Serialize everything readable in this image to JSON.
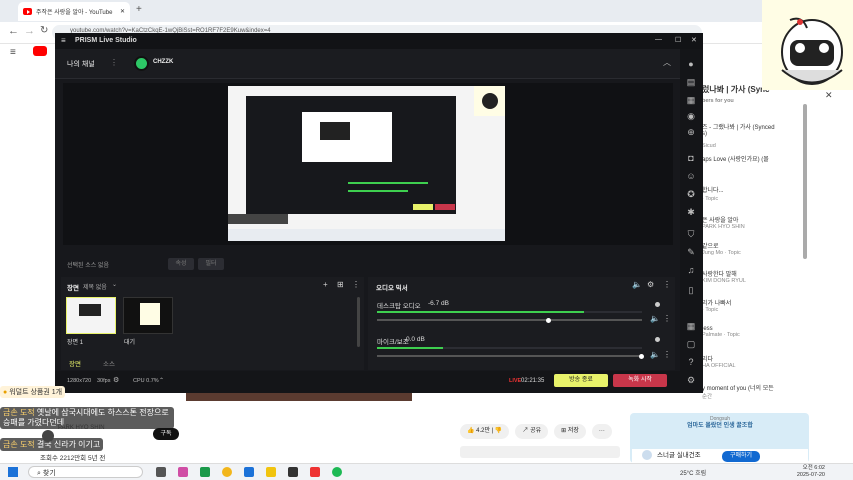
{
  "browser": {
    "tab_title": "주작은 사랑을 알아 - YouTube",
    "url": "youtube.com/watch?v=KaCtzCkqE-1wQjBiSst=RO1RF7F2E9Kuw&index=4",
    "window_controls": [
      "—",
      "☐",
      "✕"
    ]
  },
  "prism": {
    "app_name": "PRISM Live Studio",
    "channel_tab": "나의 채널",
    "channel_name": "CHZZK",
    "selected_source_label": "선택된 소스 없음",
    "source_btn_1": "속성",
    "source_btn_2": "필터",
    "scene_label": "장면",
    "scene_name_label": "제목 없음",
    "scenes": [
      {
        "name": "장면 1"
      },
      {
        "name": "대기"
      }
    ],
    "tabs": {
      "scene": "장면",
      "source": "소스"
    },
    "audio_mixer_label": "오디오 믹서",
    "audio_channels": [
      {
        "name": "데스크탑 오디오",
        "db": "-6.7 dB",
        "level": 0.78,
        "volume": 0.65
      },
      {
        "name": "마이크/보조",
        "db": "0.0 dB",
        "level": 0.25,
        "volume": 1.0
      }
    ],
    "status": {
      "resolution": "1280x720",
      "fps": "30fps",
      "cpu": "CPU 0.7%",
      "live_label": "LIVE",
      "live_time": "02:21:35",
      "broadcast_button": "방송 종료",
      "record_button": "녹화 시작"
    },
    "colors": {
      "live_btn": "#e8f26a",
      "record_btn": "#c8364a",
      "meter": "#3ecf4f"
    }
  },
  "youtube_sidebar": {
    "items": [
      {
        "title": "렀나봐 | 가사 (Sync",
        "sub": "bers for you"
      },
      {
        "title": "즈 - 그랬나봐 | 가사 (Synced",
        "sub": "s)"
      },
      {
        "title": "Sicud",
        "sub": ""
      },
      {
        "title": "aps Love (사랑인가요) (몰",
        "sub": ""
      },
      {
        "title": "합니다...",
        "sub": ""
      },
      {
        "title": "· Topic",
        "sub": ""
      },
      {
        "title": "은 사랑을 알아",
        "sub": "PARK HYO SHIN"
      },
      {
        "title": "같으로",
        "sub": "Jung Mo · Topic"
      },
      {
        "title": "사랑한다 말해",
        "sub": "KIM DONG RYUL"
      },
      {
        "title": "리가 나빠서",
        "sub": "· Topic"
      },
      {
        "title": "less",
        "sub": "Palmate · Topic"
      },
      {
        "title": "리다",
        "sub": "HA OFFICIAL"
      },
      {
        "title": "y moment of you (너의 모든",
        "sub": "순간"
      }
    ]
  },
  "video_page": {
    "likes": "4.2만",
    "share": "공유",
    "save": "저장",
    "subscribe": "구독",
    "channel": "PARK HYO SHIN",
    "views": "조회수 2212만회 5년 전",
    "more": "···"
  },
  "chat": [
    {
      "user": "금손 도적",
      "text": "옛날에 삼국시대에도 하스스톤 전장으로 승패를 가렸다던데"
    },
    {
      "user": "금손 도적",
      "text": "결국 신라가 이기고"
    }
  ],
  "badge": "워덜트 상품권 1개",
  "promo": {
    "brand": "Dongsuh",
    "text": "엄마도 몰랐던 인생 꿀조합",
    "product": "스너글 실내건조",
    "sub": "스너글 실내건조",
    "buy": "구매하기"
  },
  "taskbar": {
    "search": "찾기",
    "weather": "25°C 흐림",
    "time": "오전 6:02",
    "date": "2025-07-20"
  }
}
